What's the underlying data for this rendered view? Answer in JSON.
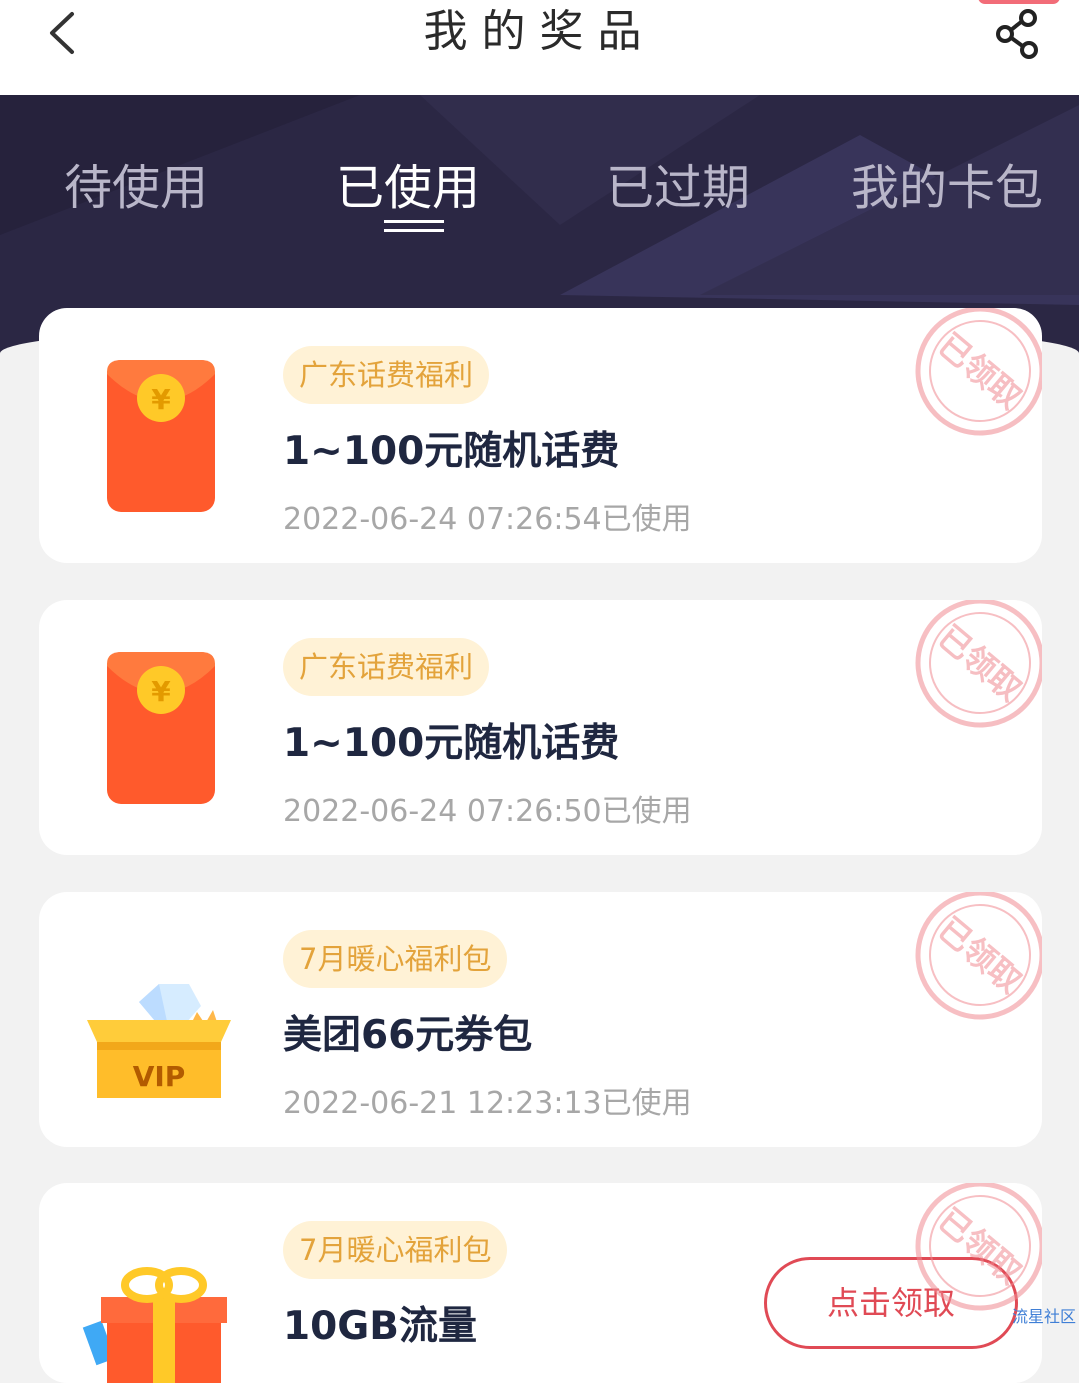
{
  "header": {
    "title": "我的奖品"
  },
  "tabs": [
    {
      "label": "待使用",
      "active": false
    },
    {
      "label": "已使用",
      "active": true
    },
    {
      "label": "已过期",
      "active": false
    },
    {
      "label": "我的卡包",
      "active": false
    }
  ],
  "prizes": [
    {
      "tag": "广东话费福利",
      "name": "1~100元随机话费",
      "time": "2022-06-24 07:26:54已使用",
      "icon": "red-envelope-icon",
      "stamp": "已领取"
    },
    {
      "tag": "广东话费福利",
      "name": "1~100元随机话费",
      "time": "2022-06-24 07:26:50已使用",
      "icon": "red-envelope-icon",
      "stamp": "已领取"
    },
    {
      "tag": "7月暖心福利包",
      "name": "美团66元券包",
      "time": "2022-06-21 12:23:13已使用",
      "icon": "vip-box-icon",
      "icon_text": "VIP",
      "stamp": "已领取"
    },
    {
      "tag": "7月暖心福利包",
      "name": "10GB流量",
      "time": "",
      "icon": "gift-box-icon",
      "stamp": "已领取",
      "button": "点击领取"
    }
  ],
  "icons": {
    "envelope_symbol": "¥"
  },
  "watermark": "流星社区",
  "colors": {
    "hero": "#2b2744",
    "tag_bg": "#fff2d6",
    "tag_text": "#e3a33b",
    "accent_red": "#e04a55"
  }
}
